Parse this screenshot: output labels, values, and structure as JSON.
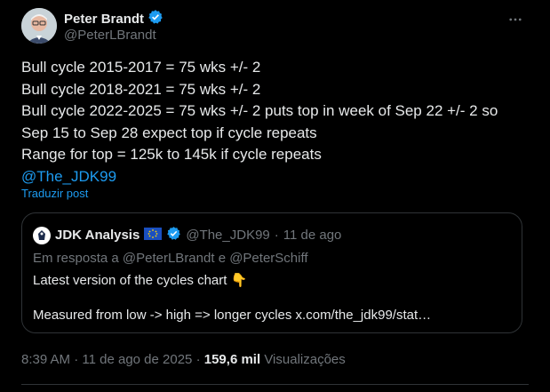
{
  "author": {
    "name": "Peter Brandt",
    "handle": "@PeterLBrandt",
    "verified": true,
    "more_icon": "more-horizontal-icon"
  },
  "post": {
    "lines": [
      "Bull cycle 2015-2017 = 75 wks +/- 2",
      "Bull cycle 2018-2021 = 75 wks +/- 2",
      "Bull cycle 2022-2025 = 75 wks +/- 2 puts top in week of Sep 22 +/- 2 so",
      "Sep 15 to Sep 28 expect top if cycle repeats",
      "Range for top = 125k to 145k if cycle repeats"
    ],
    "mention": "@The_JDK99",
    "translate_label": "Traduzir post"
  },
  "quote": {
    "name": "JDK Analysis",
    "flag_icon": "eu-flag-icon",
    "verified": true,
    "handle": "@The_JDK99",
    "separator": "·",
    "time": "11 de ago",
    "reply_prefix": "Em resposta a",
    "reply_user1": "@PeterLBrandt",
    "reply_join": "e",
    "reply_user2": "@PeterSchiff",
    "line1": "Latest version of the cycles chart",
    "line1_emoji": "👇",
    "line2": "Measured from low -> high => longer cycles x.com/the_jdk99/stat…"
  },
  "meta": {
    "time": "8:39 AM",
    "separator": "·",
    "date": "11 de ago de 2025",
    "views_count": "159,6 mil",
    "views_label": "Visualizações"
  },
  "colors": {
    "background": "#000000",
    "text": "#e7e9ea",
    "muted": "#71767b",
    "link": "#1d9bf0",
    "border": "#2f3336"
  }
}
